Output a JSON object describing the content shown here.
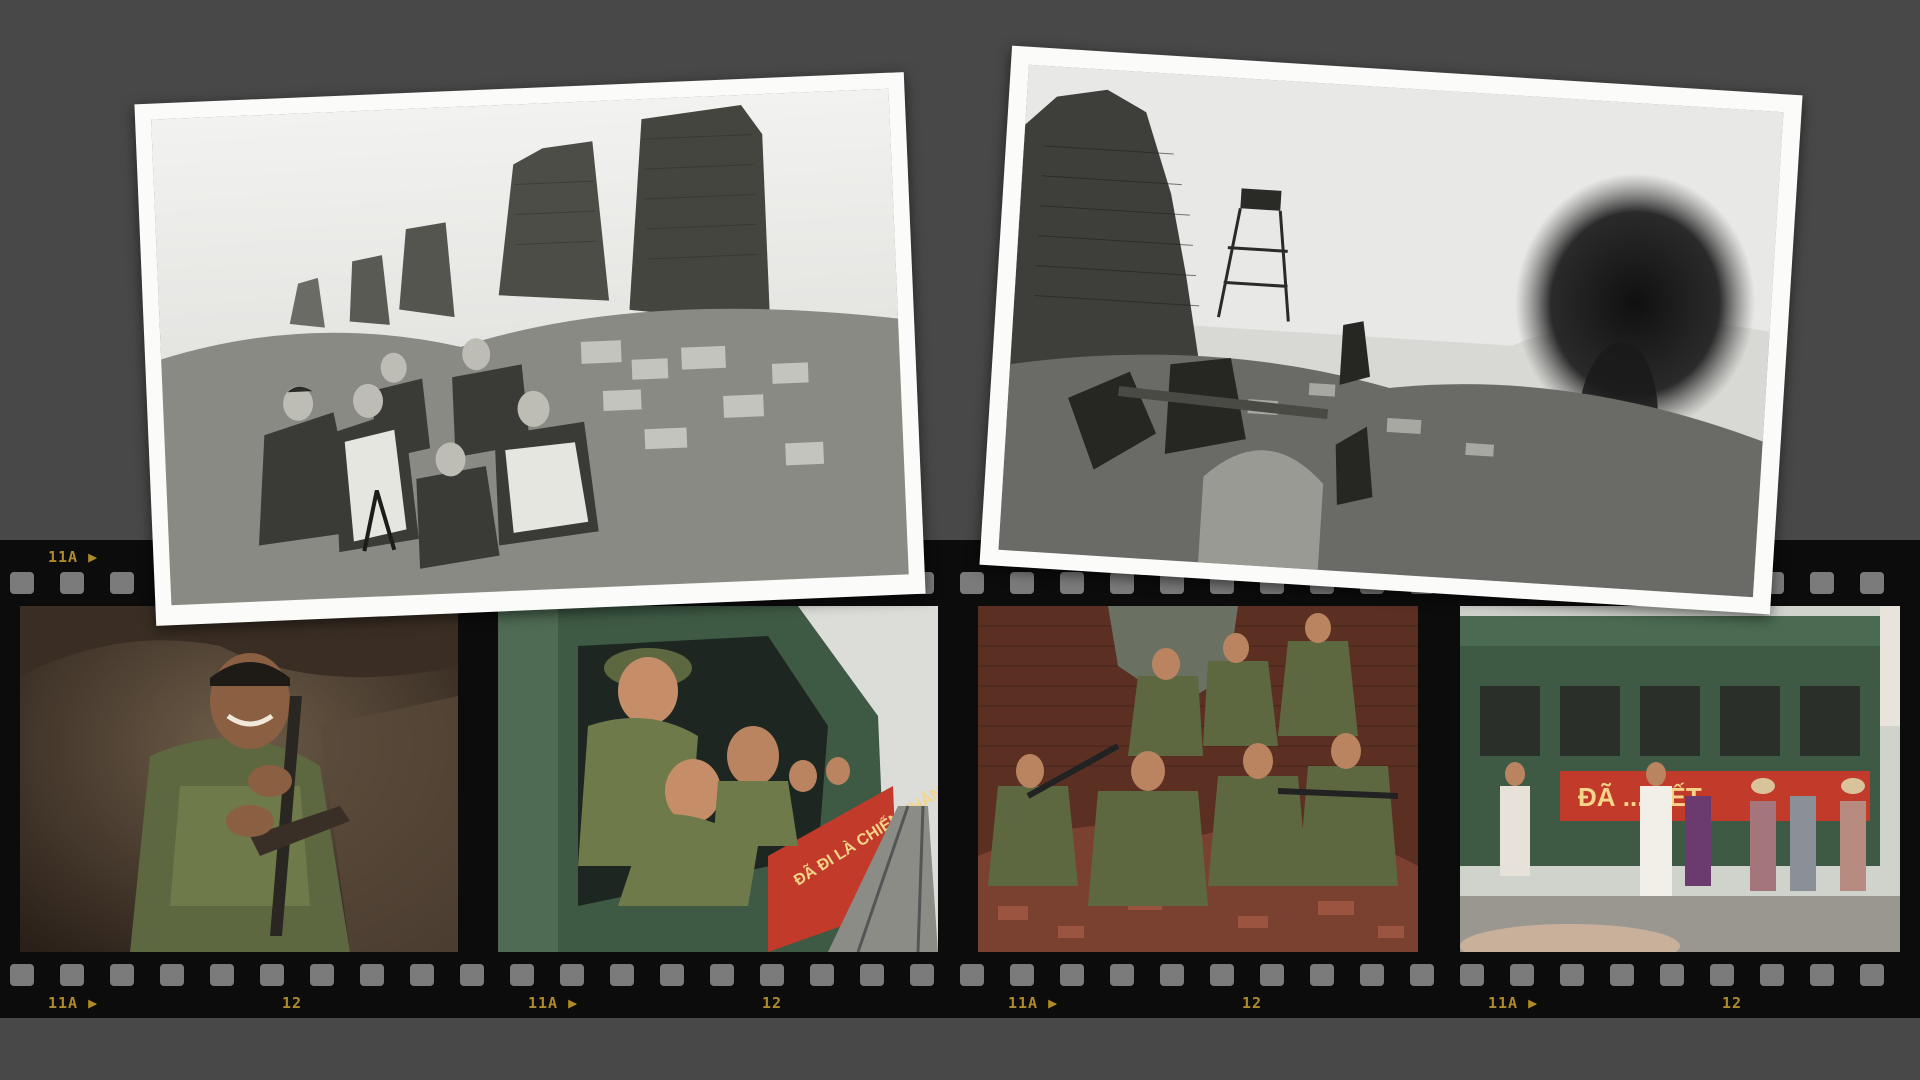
{
  "filmstrip": {
    "edge_codes": [
      "11A",
      "12"
    ],
    "frame_signs": {
      "train_side": "ĐÃ ĐI LÀ CHIẾN THẮNG",
      "station_banner": "ĐÃ  ...  YẾT"
    }
  },
  "photos": [
    {
      "name": "archive-photo-soldiers-in-ruins",
      "tone": "monochrome"
    },
    {
      "name": "archive-photo-battle-smoke",
      "tone": "monochrome"
    },
    {
      "name": "film-frame-laughing-soldier",
      "tone": "color"
    },
    {
      "name": "film-frame-soldiers-train-window",
      "tone": "color"
    },
    {
      "name": "film-frame-soldiers-on-rubble",
      "tone": "color"
    },
    {
      "name": "film-frame-train-farewell",
      "tone": "color"
    }
  ],
  "colors": {
    "background": "#484848",
    "film": "#0d0c0c",
    "edge_code": "#b08a2a",
    "uniform": "#6f7a4a",
    "train_green": "#3e5a45",
    "banner_red": "#c23a2a"
  }
}
